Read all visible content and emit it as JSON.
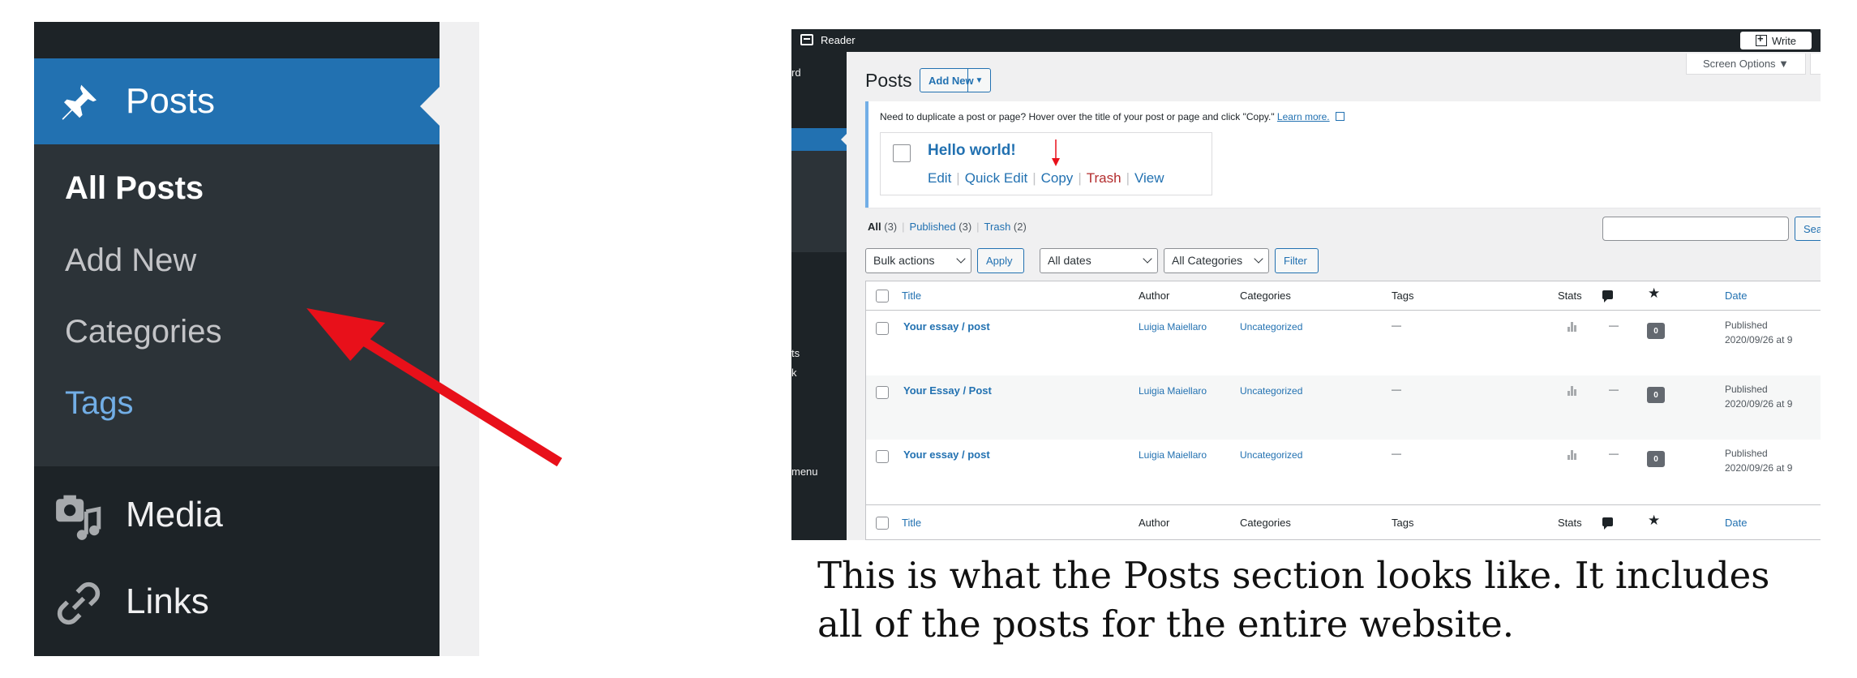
{
  "zoom_menu": {
    "posts_label": "Posts",
    "submenu": [
      "All Posts",
      "Add New",
      "Categories",
      "Tags"
    ],
    "media_label": "Media",
    "links_label": "Links"
  },
  "screenshot": {
    "topbar": {
      "reader": "Reader",
      "write": "Write"
    },
    "sidebar_fragments": [
      "rd",
      "ts",
      "k",
      "menu"
    ],
    "screen_options": "Screen Options ▼",
    "heading": "Posts",
    "add_new": "Add New",
    "notice": {
      "message": "Need to duplicate a post or page? Hover over the title of your post or page and click \"Copy.\"",
      "learn_more": "Learn more.",
      "demo_title": "Hello world!",
      "actions": [
        "Edit",
        "Quick Edit",
        "Copy",
        "Trash",
        "View"
      ]
    },
    "filters": {
      "all": "All",
      "all_count": "(3)",
      "published": "Published",
      "published_count": "(3)",
      "trash": "Trash",
      "trash_count": "(2)"
    },
    "search_button": "Sea",
    "bulk_actions": "Bulk actions",
    "apply": "Apply",
    "all_dates": "All dates",
    "all_categories": "All Categories",
    "filter": "Filter",
    "columns": {
      "title": "Title",
      "author": "Author",
      "categories": "Categories",
      "tags": "Tags",
      "stats": "Stats",
      "date": "Date"
    },
    "rows": [
      {
        "title": "Your essay / post",
        "author": "Luigia Maiellaro",
        "category": "Uncategorized",
        "tags": "—",
        "comments": "—",
        "likes": "0",
        "status": "Published",
        "date": "2020/09/26 at 9"
      },
      {
        "title": "Your Essay / Post",
        "author": "Luigia Maiellaro",
        "category": "Uncategorized",
        "tags": "—",
        "comments": "—",
        "likes": "0",
        "status": "Published",
        "date": "2020/09/26 at 9"
      },
      {
        "title": "Your essay / post",
        "author": "Luigia Maiellaro",
        "category": "Uncategorized",
        "tags": "—",
        "comments": "—",
        "likes": "0",
        "status": "Published",
        "date": "2020/09/26 at 9"
      }
    ]
  },
  "caption": "This is what the Posts section looks like. It includes all of the posts for the entire website.",
  "colors": {
    "wp_blue": "#2271b1",
    "admin_dark": "#1d2327",
    "arrow_red": "#e8101a"
  }
}
